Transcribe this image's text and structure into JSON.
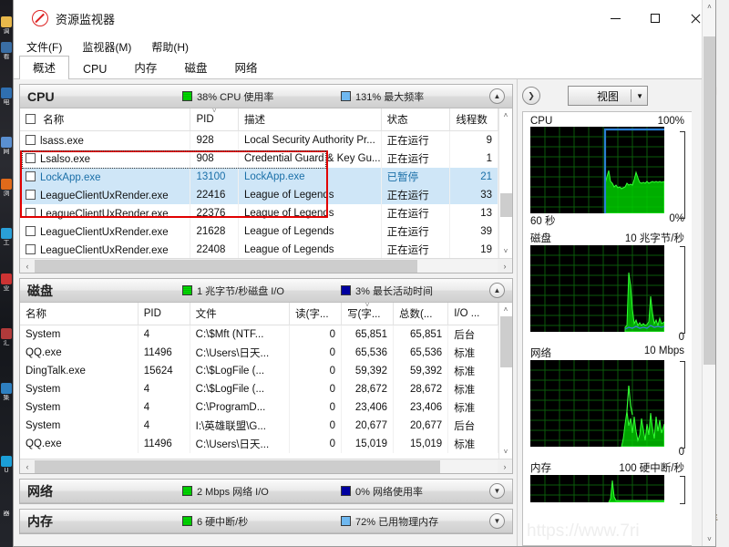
{
  "window": {
    "title": "资源监视器",
    "icon": "resource-monitor-icon",
    "minimize": "–",
    "maximize": "□",
    "close": "✕"
  },
  "menu": [
    {
      "label": "文件(F)"
    },
    {
      "label": "监视器(M)"
    },
    {
      "label": "帮助(H)"
    }
  ],
  "tabs": [
    {
      "label": "概述",
      "active": true
    },
    {
      "label": "CPU",
      "active": false
    },
    {
      "label": "内存",
      "active": false
    },
    {
      "label": "磁盘",
      "active": false
    },
    {
      "label": "网络",
      "active": false
    }
  ],
  "cpu_panel": {
    "title": "CPU",
    "stat1": "38% CPU 使用率",
    "stat2": "131% 最大频率",
    "collapse_icon": "chevron-up-icon",
    "columns": [
      "名称",
      "PID",
      "描述",
      "状态",
      "线程数"
    ],
    "rows": [
      {
        "name": "lsass.exe",
        "pid": "928",
        "desc": "Local Security Authority Pr...",
        "status": "正在运行",
        "threads": "9",
        "state": "normal"
      },
      {
        "name": "Lsalso.exe",
        "pid": "908",
        "desc": "Credential Guard & Key Gu...",
        "status": "正在运行",
        "threads": "1",
        "state": "normal"
      },
      {
        "name": "LockApp.exe",
        "pid": "13100",
        "desc": "LockApp.exe",
        "status": "已暂停",
        "threads": "21",
        "state": "suspended"
      },
      {
        "name": "LeagueClientUxRender.exe",
        "pid": "22416",
        "desc": "League of Legends",
        "status": "正在运行",
        "threads": "33",
        "state": "focused"
      },
      {
        "name": "LeagueClientUxRender.exe",
        "pid": "22376",
        "desc": "League of Legends",
        "status": "正在运行",
        "threads": "13",
        "state": "normal"
      },
      {
        "name": "LeagueClientUxRender.exe",
        "pid": "21628",
        "desc": "League of Legends",
        "status": "正在运行",
        "threads": "39",
        "state": "normal"
      },
      {
        "name": "LeagueClientUxRender.exe",
        "pid": "22408",
        "desc": "League of Legends",
        "status": "正在运行",
        "threads": "19",
        "state": "normal"
      }
    ]
  },
  "disk_panel": {
    "title": "磁盘",
    "stat1": "1 兆字节/秒磁盘 I/O",
    "stat2": "3% 最长活动时间",
    "collapse_icon": "chevron-up-icon",
    "columns": [
      "名称",
      "PID",
      "文件",
      "读(字...",
      "写(字...",
      "总数(...",
      "I/O ..."
    ],
    "rows": [
      {
        "name": "System",
        "pid": "4",
        "file": "C:\\$Mft (NTF...",
        "read": "0",
        "write": "65,851",
        "total": "65,851",
        "io": "后台"
      },
      {
        "name": "QQ.exe",
        "pid": "11496",
        "file": "C:\\Users\\日天...",
        "read": "0",
        "write": "65,536",
        "total": "65,536",
        "io": "标准"
      },
      {
        "name": "DingTalk.exe",
        "pid": "15624",
        "file": "C:\\$LogFile (...",
        "read": "0",
        "write": "59,392",
        "total": "59,392",
        "io": "标准"
      },
      {
        "name": "System",
        "pid": "4",
        "file": "C:\\$LogFile (...",
        "read": "0",
        "write": "28,672",
        "total": "28,672",
        "io": "标准"
      },
      {
        "name": "System",
        "pid": "4",
        "file": "C:\\ProgramD...",
        "read": "0",
        "write": "23,406",
        "total": "23,406",
        "io": "标准"
      },
      {
        "name": "System",
        "pid": "4",
        "file": "I:\\英雄联盟\\G...",
        "read": "0",
        "write": "20,677",
        "total": "20,677",
        "io": "后台"
      },
      {
        "name": "QQ.exe",
        "pid": "11496",
        "file": "C:\\Users\\日天...",
        "read": "0",
        "write": "15,019",
        "total": "15,019",
        "io": "标准"
      }
    ]
  },
  "network_panel": {
    "title": "网络",
    "stat1": "2 Mbps 网络 I/O",
    "stat2": "0% 网络使用率",
    "collapse_icon": "chevron-down-icon"
  },
  "memory_panel": {
    "title": "内存",
    "stat1": "6 硬中断/秒",
    "stat2": "72% 已用物理内存",
    "collapse_icon": "chevron-down-icon"
  },
  "right_pane": {
    "expand_icon": "chevron-right-icon",
    "view_label": "视图",
    "view_caret": "▼",
    "watermark": "https://www.7ri",
    "graphs": [
      {
        "title": "CPU",
        "max": "100%",
        "foot_left": "60 秒",
        "foot_right": "0%"
      },
      {
        "title": "磁盘",
        "max": "10 兆字节/秒",
        "foot_left": "",
        "foot_right": "0"
      },
      {
        "title": "网络",
        "max": "10 Mbps",
        "foot_left": "",
        "foot_right": "0"
      },
      {
        "title": "内存",
        "max": "100 硬中断/秒",
        "foot_left": "",
        "foot_right": ""
      }
    ]
  },
  "scrollbars": {
    "up_arrow": "˄",
    "down_arrow": "˅",
    "left_arrow": "‹",
    "right_arrow": "›"
  },
  "colors": {
    "accent_green": "#00cc00",
    "accent_blue_light": "#6fb8f0",
    "accent_blue_dark": "#0000a0",
    "selection": "#cfe6f7",
    "annotation_red": "#e10000"
  }
}
